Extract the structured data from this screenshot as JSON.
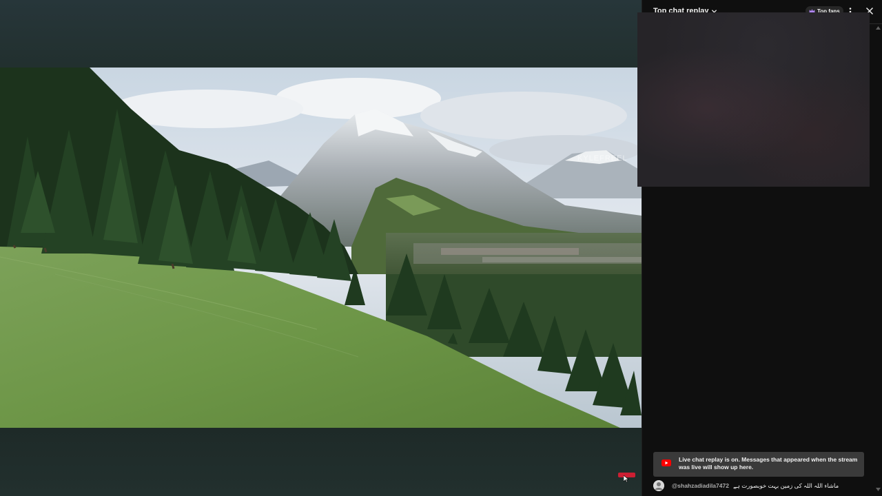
{
  "video": {
    "watermark": "KYLEFREEL"
  },
  "chat": {
    "title": "Top chat replay",
    "top_fans_label": "Top fans",
    "notice": "Live chat replay is on. Messages that appeared when the stream was live will show up here.",
    "messages": [
      {
        "author": "@shahzadiadila7472",
        "text": "ماشاء اللہ اللہ کی زمین بہت خوبصورت ہے"
      }
    ]
  },
  "icons": {
    "chat_title_dropdown": "chevron-down-icon",
    "top_fans": "crown-icon",
    "more": "more-vert-icon",
    "close": "close-icon",
    "notice_badge": "youtube-icon",
    "cursor": "mouse-cursor-icon"
  },
  "colors": {
    "chat_background": "#0f0f0f",
    "notice_background": "#3a3a3a",
    "accent_red": "#ff0000",
    "mini_live_badge": "#cc1f33"
  }
}
